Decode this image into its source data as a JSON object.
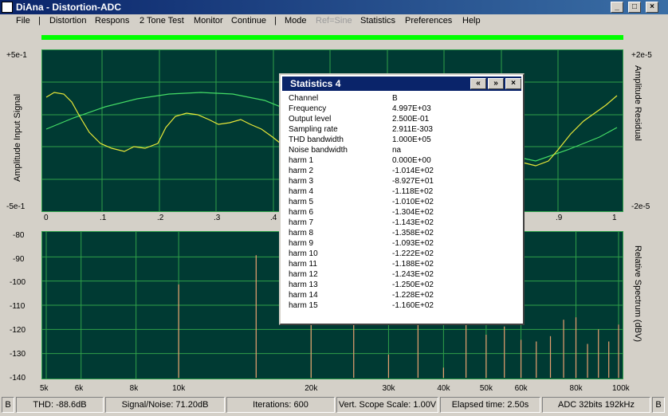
{
  "window": {
    "title": "DiAna - Distortion-ADC"
  },
  "menu": {
    "items": [
      "File",
      "Distortion",
      "Respons",
      "2 Tone Test",
      "Monitor",
      "Continue",
      "Mode",
      "Ref=Sine",
      "Statistics",
      "Preferences",
      "Help"
    ]
  },
  "top_plot": {
    "y_left_max": "+5e-1",
    "y_left_min": "-5e-1",
    "y_right_max": "+2e-5",
    "y_right_min": "-2e-5",
    "left_label": "Amplitude Input Signal",
    "right_label": "Amplitude Residual",
    "x_ticks": [
      "0",
      ".1",
      ".2",
      ".3",
      ".4",
      ".9",
      "1"
    ]
  },
  "bottom_plot": {
    "y_ticks": [
      "-80",
      "-90",
      "-100",
      "-110",
      "-120",
      "-130",
      "-140"
    ],
    "right_label": "Relative Spectrum (dBV)",
    "x_ticks": [
      "5k",
      "6k",
      "8k",
      "10k",
      "20k",
      "30k",
      "40k",
      "50k",
      "60k",
      "80k",
      "100k"
    ]
  },
  "chart_data": {
    "type": "bar",
    "title": "",
    "xlabel": "",
    "ylabel": "Relative Spectrum (dBV)",
    "ylim": [
      -140,
      -80
    ],
    "x_scale": "log",
    "xlim": [
      5000,
      100000
    ],
    "x": [
      10000,
      15000,
      20000,
      25000,
      30000,
      35000,
      40000,
      45000,
      50000,
      55000,
      60000,
      65000,
      70000,
      75000,
      80000,
      85000,
      90000,
      95000,
      100000
    ],
    "values": [
      -101.4,
      -89.3,
      -111.8,
      -101.0,
      -130.4,
      -114.3,
      -135.8,
      -109.3,
      -122.2,
      -118.8,
      -124.3,
      -125.0,
      -122.8,
      -116.0,
      -115.0,
      -126.0,
      -120.0,
      -125.0,
      -118.0
    ]
  },
  "statistics": {
    "title": "Statistics 4",
    "rows": [
      {
        "key": "Channel",
        "value": "B"
      },
      {
        "key": "Frequency",
        "value": "4.997E+03"
      },
      {
        "key": "Output level",
        "value": "2.500E-01"
      },
      {
        "key": "Sampling rate",
        "value": "2.911E-303"
      },
      {
        "key": "THD bandwidth",
        "value": "1.000E+05"
      },
      {
        "key": "Noise bandwidth",
        "value": "na"
      },
      {
        "key": "harm 1",
        "value": "0.000E+00"
      },
      {
        "key": "harm 2",
        "value": "-1.014E+02"
      },
      {
        "key": "harm 3",
        "value": "-8.927E+01"
      },
      {
        "key": "harm 4",
        "value": "-1.118E+02"
      },
      {
        "key": "harm 5",
        "value": "-1.010E+02"
      },
      {
        "key": "harm 6",
        "value": "-1.304E+02"
      },
      {
        "key": "harm 7",
        "value": "-1.143E+02"
      },
      {
        "key": "harm 8",
        "value": "-1.358E+02"
      },
      {
        "key": "harm 9",
        "value": "-1.093E+02"
      },
      {
        "key": "harm 10",
        "value": "-1.222E+02"
      },
      {
        "key": "harm 11",
        "value": "-1.188E+02"
      },
      {
        "key": "harm 12",
        "value": "-1.243E+02"
      },
      {
        "key": "harm 13",
        "value": "-1.250E+02"
      },
      {
        "key": "harm 14",
        "value": "-1.228E+02"
      },
      {
        "key": "harm 15",
        "value": "-1.160E+02"
      }
    ]
  },
  "status": {
    "channel_left": "B",
    "thd": "THD:  -88.6dB",
    "snr": "Signal/Noise:  71.20dB",
    "iterations": "Iterations: 600",
    "vscale": "Vert. Scope Scale: 1.00V",
    "elapsed": "Elapsed time: 2.50s",
    "adc": "ADC 32bits 192kHz",
    "channel_right": "B"
  },
  "colors": {
    "plot_bg": "#003a33",
    "grid": "#2fa04a",
    "signal": "#e8e838",
    "residual": "#44dd66",
    "bars": "#e8a070"
  }
}
